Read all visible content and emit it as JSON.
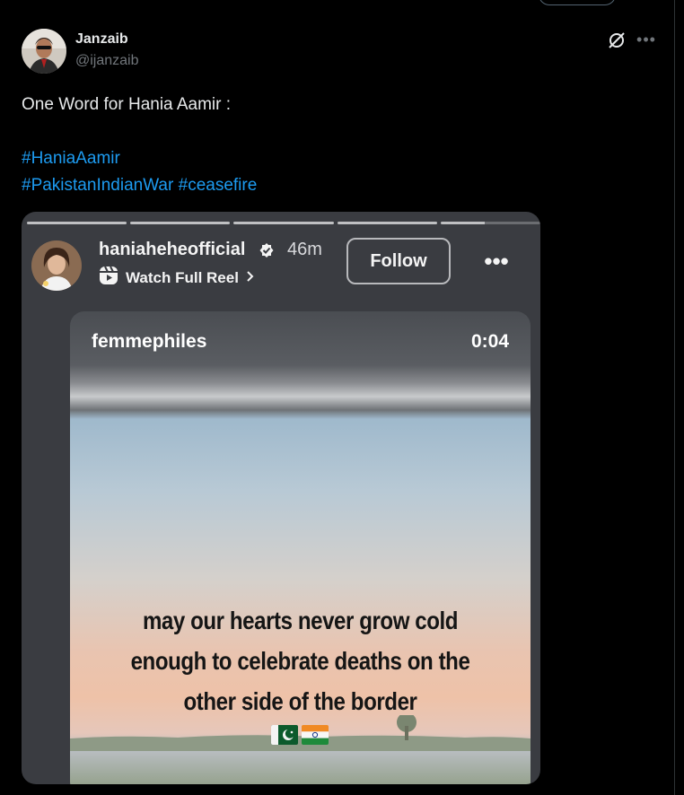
{
  "post": {
    "author_name": "Janzaib",
    "author_handle": "@ijanzaib",
    "text": "One Word for Hania Aamir :",
    "hashtags_line1": "#HaniaAamir",
    "hashtags_line2_a": "#PakistanIndianWar",
    "hashtags_line2_b": "#ceasefire",
    "grok_icon": "grok-icon",
    "more_icon": "more-icon"
  },
  "story": {
    "username": "haniaheheofficial",
    "time": "46m",
    "watch_reel": "Watch Full Reel",
    "follow": "Follow",
    "more": "•••",
    "progress_segments": 5,
    "video": {
      "source_user": "femmephiles",
      "timestamp": "0:04",
      "caption_line1": "may our hearts never grow cold",
      "caption_line2": "enough to celebrate deaths on the",
      "caption_line3": "other side of the border",
      "flags": [
        "pakistan-flag",
        "india-flag"
      ]
    }
  },
  "colors": {
    "background": "#000000",
    "accent": "#1d9bf0",
    "muted": "#71767b"
  }
}
